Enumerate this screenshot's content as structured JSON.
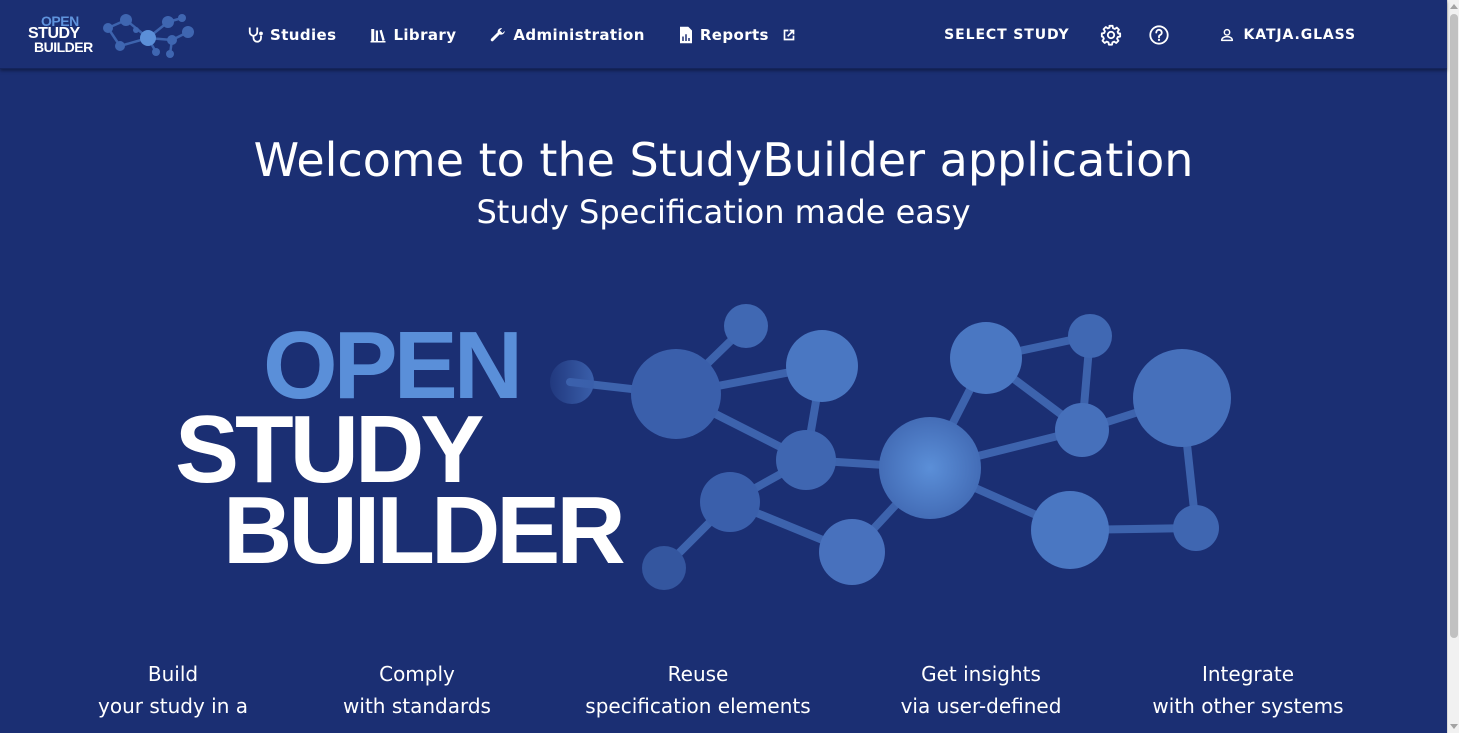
{
  "brand": {
    "line1": "OPEN",
    "line2": "STUDY",
    "line3": "BUILDER"
  },
  "nav": {
    "items": [
      {
        "label": "Studies",
        "icon": "stethoscope-icon"
      },
      {
        "label": "Library",
        "icon": "books-icon"
      },
      {
        "label": "Administration",
        "icon": "wrench-icon"
      },
      {
        "label": "Reports",
        "icon": "report-icon",
        "external_icon": "open-in-new-icon"
      }
    ],
    "select_study": "SELECT STUDY",
    "settings_icon": "gear-icon",
    "help_icon": "help-circle-icon",
    "user": "KATJA.GLASS",
    "user_icon": "account-icon"
  },
  "hero": {
    "title": "Welcome to the StudyBuilder application",
    "subtitle": "Study Specification made easy"
  },
  "logo": {
    "line1": "OPEN",
    "line2": "STUDY",
    "line3": "BUILDER"
  },
  "features": [
    {
      "heading": "Build",
      "line": "your study in a"
    },
    {
      "heading": "Comply",
      "line": "with standards"
    },
    {
      "heading": "Reuse",
      "line": "specification elements"
    },
    {
      "heading": "Get insights",
      "line": "via user-defined"
    },
    {
      "heading": "Integrate",
      "line": "with other systems"
    }
  ],
  "colors": {
    "background": "#1b2f73",
    "accent": "#5a8fd9",
    "node_dark": "#3a5fab",
    "node_light": "#5b8fd8"
  }
}
